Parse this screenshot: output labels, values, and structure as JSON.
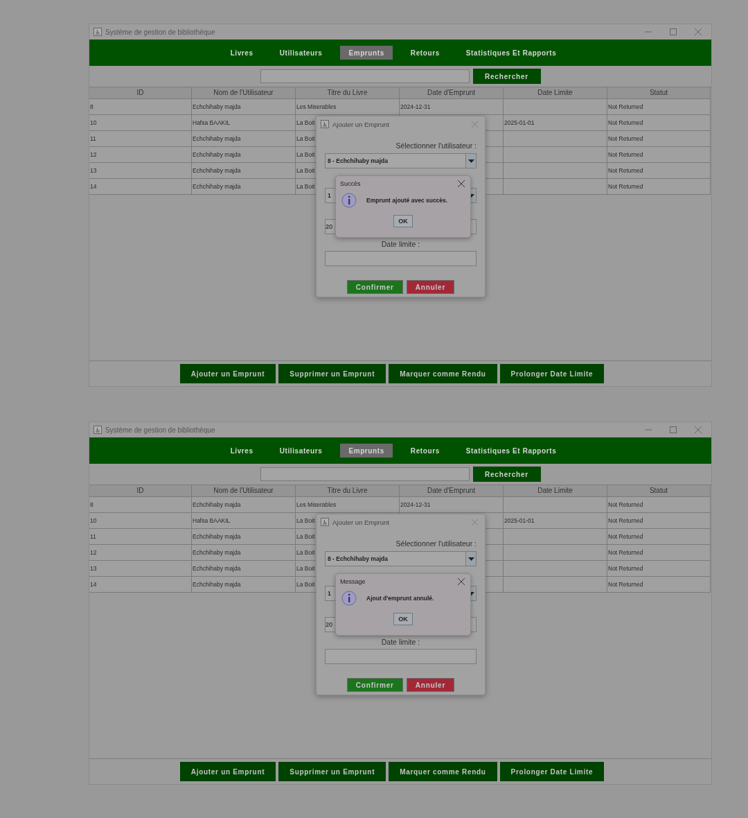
{
  "windows": [
    {
      "title": "Système de gestion de bibliothèque",
      "tabs": [
        {
          "label": "Livres",
          "selected": false
        },
        {
          "label": "Utilisateurs",
          "selected": false
        },
        {
          "label": "Emprunts",
          "selected": true
        },
        {
          "label": "Retours",
          "selected": false
        },
        {
          "label": "Statistiques Et Rapports",
          "selected": false
        }
      ],
      "search_button": "Rechercher",
      "table": {
        "columns": [
          "ID",
          "Nom de l'Utilisateur",
          "Titre du Livre",
          "Date d'Emprunt",
          "Date Limite",
          "Statut"
        ],
        "rows": [
          [
            "8",
            "Echchihaby majda",
            "Les Miserables",
            "2024-12-31",
            null,
            "Not Returned"
          ],
          [
            "10",
            "Hafsa BAAKIL",
            "La Boit",
            null,
            "2025-01-01",
            "Not Returned"
          ],
          [
            "11",
            "Echchihaby majda",
            "La Boit",
            null,
            null,
            "Not Returned"
          ],
          [
            "12",
            "Echchihaby majda",
            "La Boit",
            null,
            null,
            "Not Returned"
          ],
          [
            "13",
            "Echchihaby majda",
            "La Boit",
            null,
            null,
            "Not Returned"
          ],
          [
            "14",
            "Echchihaby majda",
            "La Boit",
            null,
            null,
            "Not Returned"
          ]
        ]
      },
      "dialog": {
        "title": "Ajouter un Emprunt",
        "user_label": "Sélectionner l'utilisateur :",
        "user_value": "8 - Echchihaby majda",
        "book_value": "1",
        "date_value": "20",
        "limit_label": "Date limite :",
        "buttons": [
          {
            "label": "Confirmer",
            "kind": "confirm"
          },
          {
            "label": "Annuler",
            "kind": "cancel"
          }
        ]
      },
      "message": {
        "title": "Succès",
        "text": "Emprunt ajouté avec succès.",
        "button": "OK"
      },
      "actions": [
        "Ajouter un Emprunt",
        "Supprimer un Emprunt",
        "Marquer comme Rendu",
        "Prolonger Date Limite"
      ]
    },
    {
      "title": "Système de gestion de bibliothèque",
      "tabs": [
        {
          "label": "Livres",
          "selected": false
        },
        {
          "label": "Utilisateurs",
          "selected": false
        },
        {
          "label": "Emprunts",
          "selected": true
        },
        {
          "label": "Retours",
          "selected": false
        },
        {
          "label": "Statistiques Et Rapports",
          "selected": false
        }
      ],
      "search_button": "Rechercher",
      "table": {
        "columns": [
          "ID",
          "Nom de l'Utilisateur",
          "Titre du Livre",
          "Date d'Emprunt",
          "Date Limite",
          "Statut"
        ],
        "rows": [
          [
            "8",
            "Echchihaby majda",
            "Les Miserables",
            "2024-12-31",
            null,
            "Not Returned"
          ],
          [
            "10",
            "Hafsa BAAKIL",
            "La Boit",
            null,
            "2025-01-01",
            "Not Returned"
          ],
          [
            "11",
            "Echchihaby majda",
            "La Boit",
            null,
            null,
            "Not Returned"
          ],
          [
            "12",
            "Echchihaby majda",
            "La Boit",
            null,
            null,
            "Not Returned"
          ],
          [
            "13",
            "Echchihaby majda",
            "La Boit",
            null,
            null,
            "Not Returned"
          ],
          [
            "14",
            "Echchihaby majda",
            "La Boit",
            null,
            null,
            "Not Returned"
          ]
        ]
      },
      "dialog": {
        "title": "Ajouter un Emprunt",
        "user_label": "Sélectionner l'utilisateur :",
        "user_value": "8 - Echchihaby majda",
        "book_value": "1",
        "date_value": "20",
        "limit_label": "Date limite :",
        "buttons": [
          {
            "label": "Confirmer",
            "kind": "confirm"
          },
          {
            "label": "Annuler",
            "kind": "cancel"
          }
        ]
      },
      "message": {
        "title": "Message",
        "text": "Ajout d'emprunt annulé.",
        "button": "OK"
      },
      "actions": [
        "Ajouter un Emprunt",
        "Supprimer un Emprunt",
        "Marquer comme Rendu",
        "Prolonger Date Limite"
      ]
    }
  ]
}
